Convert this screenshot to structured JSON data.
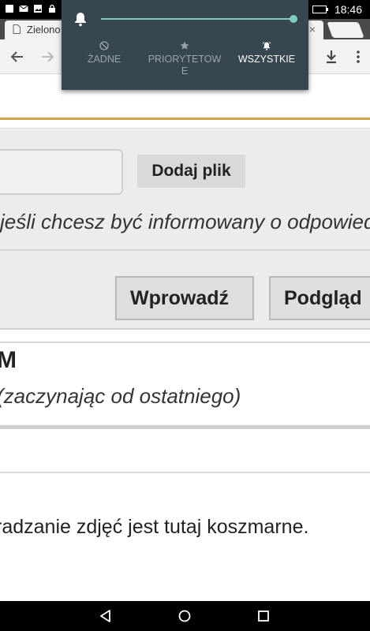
{
  "status_bar": {
    "time": "18:46"
  },
  "browser": {
    "tab_title": "Zielono",
    "tab_close": "×"
  },
  "quick_settings": {
    "options": [
      {
        "label": "ŻADNE",
        "icon": "do-not-disturb-icon",
        "selected": false
      },
      {
        "label": "PRIORYTETOWE",
        "icon": "star-icon",
        "selected": false
      },
      {
        "label": "WSZYSTKIE",
        "icon": "bell-ring-icon",
        "selected": true
      }
    ],
    "volume_level": 1.0,
    "accent_color": "#80cbc4",
    "background_color": "#37474f"
  },
  "page": {
    "add_file_label": "Dodaj plik",
    "notify_text": "jeśli chcesz być informowany o odpowiedziach",
    "submit_label": "Wprowadź",
    "preview_label": "Podgląd",
    "comments_title": "M",
    "comments_subtitle": "(zaczynając od ostatniego)",
    "comment_text": "radzanie zdjęć jest tutaj koszmarne."
  },
  "colors": {
    "accent_line": "#d1a74a"
  }
}
